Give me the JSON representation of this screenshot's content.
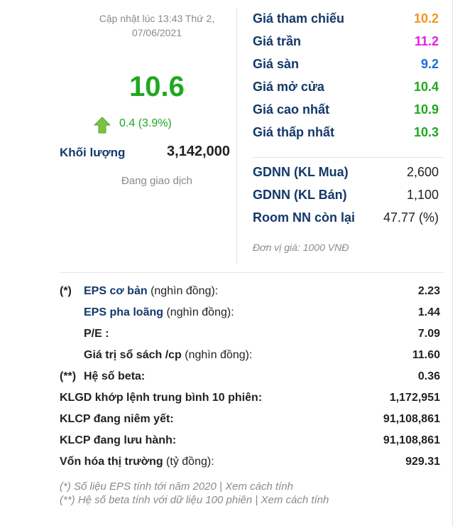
{
  "left": {
    "updated_line1": "Cập nhật lúc 13:43 Thứ 2,",
    "updated_line2": "07/06/2021",
    "price": "10.6",
    "change": "0.4 (3.9%)",
    "volume_label": "Khối lượng",
    "volume_value": "3,142,000",
    "status": "Đang giao dịch",
    "arrow_icon": "up-arrow-icon",
    "price_color": "#1fa81f"
  },
  "right": {
    "prices": [
      {
        "label": "Giá tham chiếu",
        "value": "10.2",
        "color": "#f7941d"
      },
      {
        "label": "Giá trần",
        "value": "11.2",
        "color": "#e81ee8"
      },
      {
        "label": "Giá sàn",
        "value": "9.2",
        "color": "#1a6fd6"
      },
      {
        "label": "Giá mở cửa",
        "value": "10.4",
        "color": "#1fa81f"
      },
      {
        "label": "Giá cao nhất",
        "value": "10.9",
        "color": "#1fa81f"
      },
      {
        "label": "Giá thấp nhất",
        "value": "10.3",
        "color": "#1fa81f"
      }
    ],
    "foreign": [
      {
        "label": "GDNN (KL Mua)",
        "value": "2,600"
      },
      {
        "label": "GDNN (KL Bán)",
        "value": "1,100"
      },
      {
        "label": "Room NN còn lại",
        "value": "47.77 (%)"
      }
    ],
    "unit_note": "Đơn vị giá: 1000 VNĐ"
  },
  "bottom": {
    "rows": [
      {
        "prefix": "(*)",
        "label_bold": "EPS cơ bản",
        "label_rest": " (nghìn đồng):",
        "value": "2.23"
      },
      {
        "prefix": "",
        "label_bold": "EPS pha loãng",
        "label_rest": " (nghìn đồng):",
        "value": "1.44"
      },
      {
        "prefix": "",
        "label_bold": "P/E :",
        "label_rest": "",
        "value": "7.09"
      },
      {
        "prefix": "",
        "label_bold": "Giá trị sổ sách /cp",
        "label_rest": " (nghìn đồng):",
        "value": "11.60"
      },
      {
        "prefix": "(**)",
        "label_bold": "Hệ số beta:",
        "label_rest": "",
        "value": "0.36"
      },
      {
        "prefix": "",
        "label_bold": "KLGD khớp lệnh trung bình 10 phiên:",
        "label_rest": "",
        "value": "1,172,951"
      },
      {
        "prefix": "",
        "label_bold": "KLCP đang niêm yết:",
        "label_rest": "",
        "value": "91,108,861"
      },
      {
        "prefix": "",
        "label_bold": "KLCP đang lưu hành:",
        "label_rest": "",
        "value": "91,108,861"
      },
      {
        "prefix": "",
        "label_bold": "Vốn hóa thị trường",
        "label_rest": " (tỷ đồng):",
        "value": "929.31"
      }
    ],
    "note1_text": "(*) Số liệu EPS tính tới năm 2020 | ",
    "note1_link": "Xem cách tính",
    "note2_text": "(**) Hệ số beta tính với dữ liệu 100 phiên | ",
    "note2_link": "Xem cách tính"
  }
}
